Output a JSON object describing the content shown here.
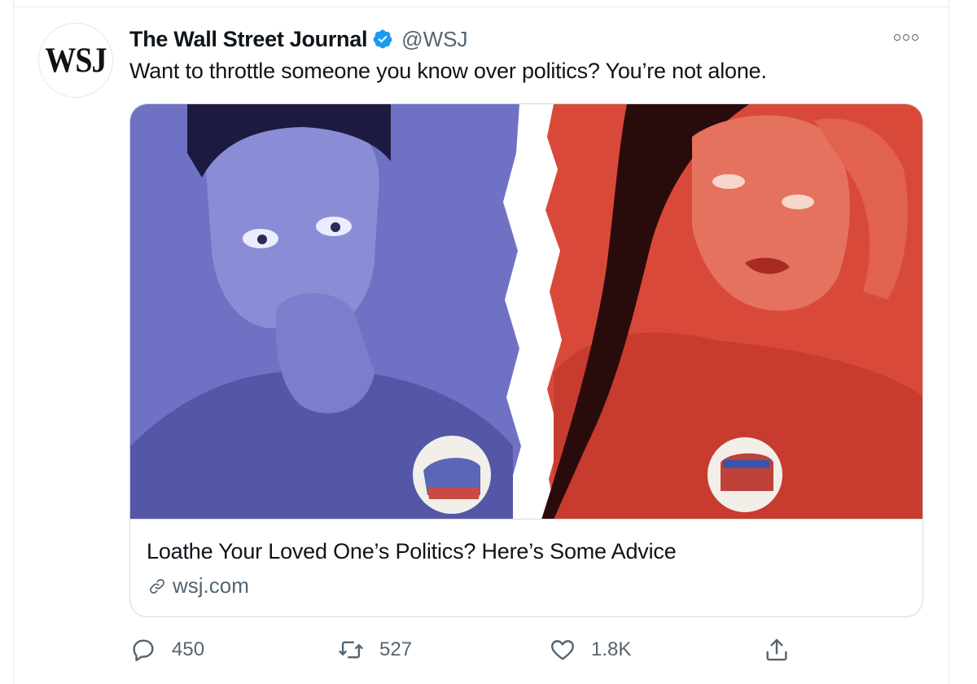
{
  "tweet": {
    "avatar_text": "WSJ",
    "display_name": "The Wall Street Journal",
    "handle": "@WSJ",
    "text": "Want to throttle someone you know over politics? You’re not alone."
  },
  "card": {
    "title": "Loathe Your Loved One’s Politics? Here’s Some Advice",
    "domain": "wsj.com",
    "colors": {
      "left_panel": "#6f72c4",
      "right_panel": "#d9493a"
    }
  },
  "actions": {
    "reply_count": "450",
    "retweet_count": "527",
    "like_count": "1.8K"
  },
  "icons": [
    "verified-badge-icon",
    "more-icon",
    "link-icon",
    "reply-icon",
    "retweet-icon",
    "like-icon",
    "share-icon"
  ],
  "colors": {
    "verified": "#1d9bf0",
    "muted": "#536471",
    "border": "#cfd9de"
  }
}
